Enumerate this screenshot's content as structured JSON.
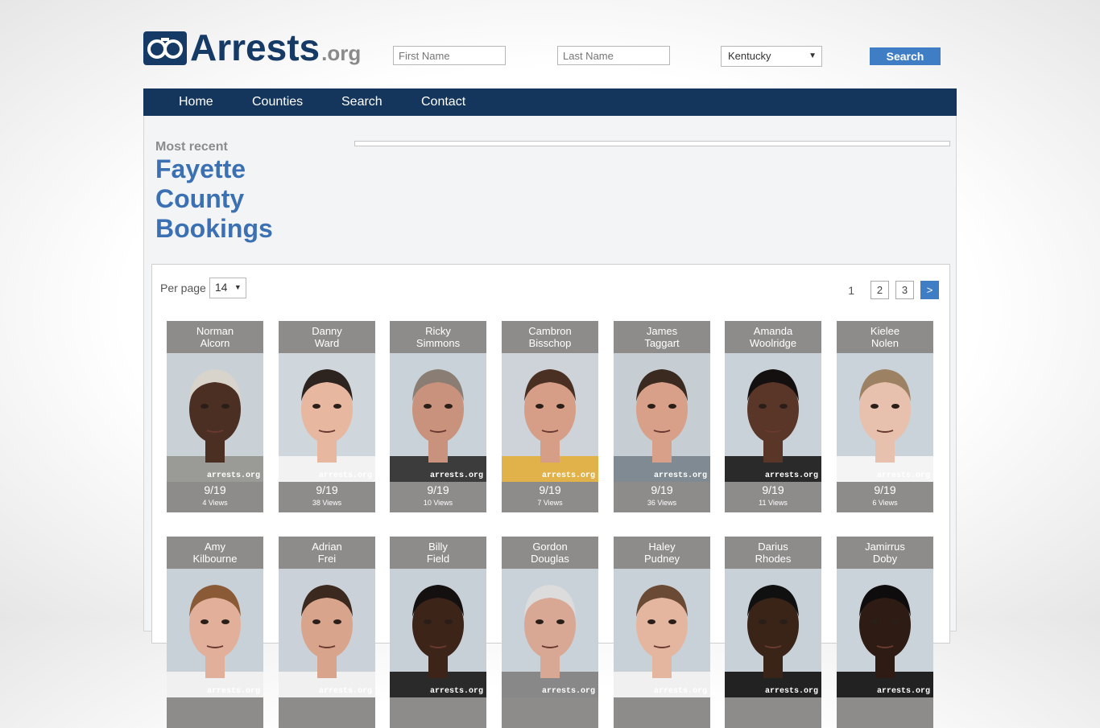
{
  "site": {
    "logo_text": "Arrests",
    "logo_suffix": ".org"
  },
  "header": {
    "first_name_placeholder": "First Name",
    "last_name_placeholder": "Last Name",
    "state_selected": "Kentucky",
    "search_label": "Search"
  },
  "nav": {
    "items": [
      {
        "label": "Home"
      },
      {
        "label": "Counties"
      },
      {
        "label": "Search"
      },
      {
        "label": "Contact"
      }
    ]
  },
  "page": {
    "subtitle": "Most recent",
    "title_lines": [
      "Fayette",
      "County",
      "Bookings"
    ]
  },
  "listing": {
    "per_page_label": "Per page",
    "per_page_value": "14",
    "pager": {
      "current": "1",
      "pages": [
        "2",
        "3"
      ],
      "next": ">"
    },
    "watermark": "arrests.org",
    "bookings": [
      {
        "first": "Norman",
        "last": "Alcorn",
        "date": "9/19",
        "views": "4 Views",
        "skin": "#4a2f22",
        "hair": "#d8d4cc",
        "bg": "#c9d0d6",
        "shirt": "#9a9a96"
      },
      {
        "first": "Danny",
        "last": "Ward",
        "date": "9/19",
        "views": "38 Views",
        "skin": "#e7b7a0",
        "hair": "#2d2420",
        "bg": "#cfd6dc",
        "shirt": "#f2f2f2"
      },
      {
        "first": "Ricky",
        "last": "Simmons",
        "date": "9/19",
        "views": "10 Views",
        "skin": "#c8927c",
        "hair": "#8a7e74",
        "bg": "#c8d2d8",
        "shirt": "#3c3c3c"
      },
      {
        "first": "Cambron",
        "last": "Bisschop",
        "date": "9/19",
        "views": "7 Views",
        "skin": "#d69e86",
        "hair": "#4a3022",
        "bg": "#cdd3d8",
        "shirt": "#e2b24a"
      },
      {
        "first": "James",
        "last": "Taggart",
        "date": "9/19",
        "views": "36 Views",
        "skin": "#d8a088",
        "hair": "#3a2a20",
        "bg": "#c6ced4",
        "shirt": "#7f8a92"
      },
      {
        "first": "Amanda",
        "last": "Woolridge",
        "date": "9/19",
        "views": "11 Views",
        "skin": "#5a3628",
        "hair": "#141010",
        "bg": "#c9d2d9",
        "shirt": "#2a2a2a"
      },
      {
        "first": "Kielee",
        "last": "Nolen",
        "date": "9/19",
        "views": "6 Views",
        "skin": "#e8c0ae",
        "hair": "#9c8262",
        "bg": "#cbd3da",
        "shirt": "#f4f4f4"
      },
      {
        "first": "Amy",
        "last": "Kilbourne",
        "date": "",
        "views": "",
        "skin": "#e2b09a",
        "hair": "#8a5a36",
        "bg": "#c9d1d8",
        "shirt": "#f0f0f0"
      },
      {
        "first": "Adrian",
        "last": "Frei",
        "date": "",
        "views": "",
        "skin": "#d9a48c",
        "hair": "#3b281e",
        "bg": "#cad1d8",
        "shirt": "#f0f0f0"
      },
      {
        "first": "Billy",
        "last": "Field",
        "date": "",
        "views": "",
        "skin": "#3c2419",
        "hair": "#151010",
        "bg": "#c8d0d7",
        "shirt": "#2a2a2a"
      },
      {
        "first": "Gordon",
        "last": "Douglas",
        "date": "",
        "views": "",
        "skin": "#d8a894",
        "hair": "#dcdcdc",
        "bg": "#cad2d9",
        "shirt": "#888"
      },
      {
        "first": "Haley",
        "last": "Pudney",
        "date": "",
        "views": "",
        "skin": "#e4b6a0",
        "hair": "#6a4a34",
        "bg": "#c9d1d8",
        "shirt": "#f0f0f0"
      },
      {
        "first": "Darius",
        "last": "Rhodes",
        "date": "",
        "views": "",
        "skin": "#3a2418",
        "hair": "#101010",
        "bg": "#c9d1d8",
        "shirt": "#222"
      },
      {
        "first": "Jamirrus",
        "last": "Doby",
        "date": "",
        "views": "",
        "skin": "#2e1c14",
        "hair": "#0e0c0c",
        "bg": "#cbd3da",
        "shirt": "#222"
      }
    ]
  }
}
